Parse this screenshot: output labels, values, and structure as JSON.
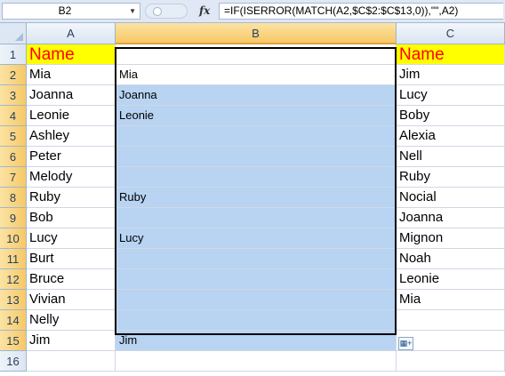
{
  "formula_bar": {
    "name_box": "B2",
    "fx_label": "fx",
    "formula": "=IF(ISERROR(MATCH(A2,$C$2:$C$13,0)),\"\",A2)"
  },
  "columns": [
    "A",
    "B",
    "C"
  ],
  "rows": [
    "1",
    "2",
    "3",
    "4",
    "5",
    "6",
    "7",
    "8",
    "9",
    "10",
    "11",
    "12",
    "13",
    "14",
    "15",
    "16"
  ],
  "column_a": [
    "Name",
    "Mia",
    "Joanna",
    "Leonie",
    "Ashley",
    "Peter",
    "Melody",
    "Ruby",
    "Bob",
    "Lucy",
    "Burt",
    "Bruce",
    "Vivian",
    "Nelly",
    "Jim",
    ""
  ],
  "column_b": [
    "",
    "Mia",
    "Joanna",
    "Leonie",
    "",
    "",
    "",
    "Ruby",
    "",
    "Lucy",
    "",
    "",
    "",
    "",
    "Jim",
    ""
  ],
  "column_c": [
    "Name",
    "Jim",
    "Lucy",
    "Boby",
    "Alexia",
    "Nell",
    "Ruby",
    "Nocial",
    "Joanna",
    "Mignon",
    "Noah",
    "Leonie",
    "Mia",
    "",
    "",
    ""
  ],
  "colors": {
    "header_fill": "#ffff00",
    "header_text": "#ff0000",
    "selection_fill": "#b8d4f2",
    "selected_header": "#f7c867"
  }
}
